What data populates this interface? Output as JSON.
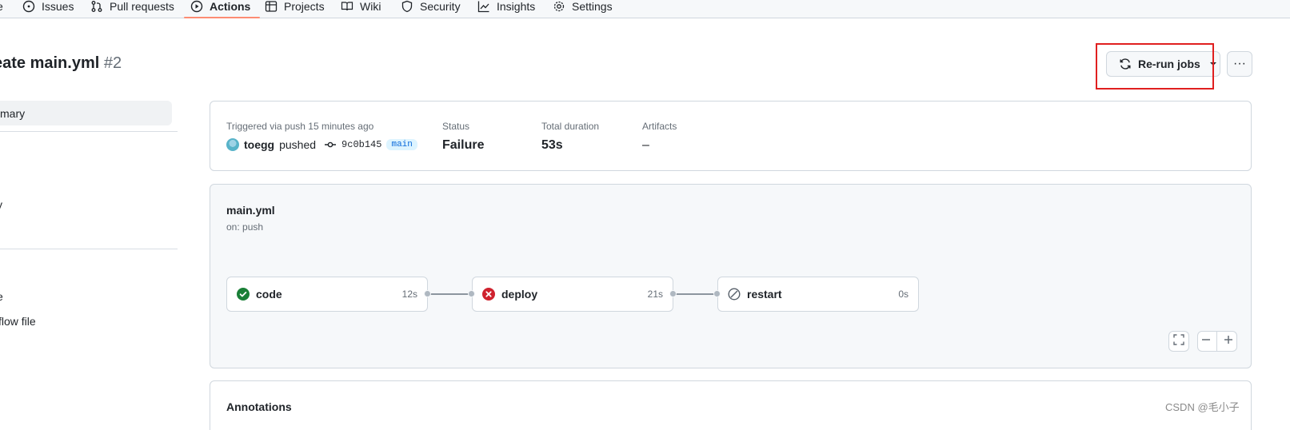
{
  "nav": {
    "items": [
      {
        "label": "Issues",
        "icon": "issue-icon"
      },
      {
        "label": "Pull requests",
        "icon": "pull-request-icon"
      },
      {
        "label": "Actions",
        "icon": "play-icon",
        "active": true
      },
      {
        "label": "Projects",
        "icon": "table-icon"
      },
      {
        "label": "Wiki",
        "icon": "book-icon"
      },
      {
        "label": "Security",
        "icon": "shield-icon"
      },
      {
        "label": "Insights",
        "icon": "graph-icon"
      },
      {
        "label": "Settings",
        "icon": "gear-icon"
      }
    ],
    "partial_left": "e"
  },
  "title": {
    "text": "eate main.yml",
    "number": "#2"
  },
  "sidebar": {
    "summary": "mary",
    "items": [
      "y",
      "t",
      "e",
      "flow file"
    ]
  },
  "actions": {
    "rerun_label": "Re-run jobs",
    "more_label": "···"
  },
  "summary": {
    "trigger_label": "Triggered via push 15 minutes ago",
    "user": "toegg",
    "pushed": "pushed",
    "commit": "9c0b145",
    "branch": "main",
    "status_label": "Status",
    "status_value": "Failure",
    "duration_label": "Total duration",
    "duration_value": "53s",
    "artifacts_label": "Artifacts",
    "artifacts_value": "–"
  },
  "workflow": {
    "name": "main.yml",
    "trigger": "on: push",
    "jobs": [
      {
        "name": "code",
        "time": "12s",
        "status": "success"
      },
      {
        "name": "deploy",
        "time": "21s",
        "status": "failure"
      },
      {
        "name": "restart",
        "time": "0s",
        "status": "skipped"
      }
    ],
    "colors": {
      "success": "#1a7f37",
      "failure": "#cf222e",
      "skipped": "#57606a"
    }
  },
  "annotations": {
    "title": "Annotations"
  },
  "watermark": "CSDN @毛小子"
}
